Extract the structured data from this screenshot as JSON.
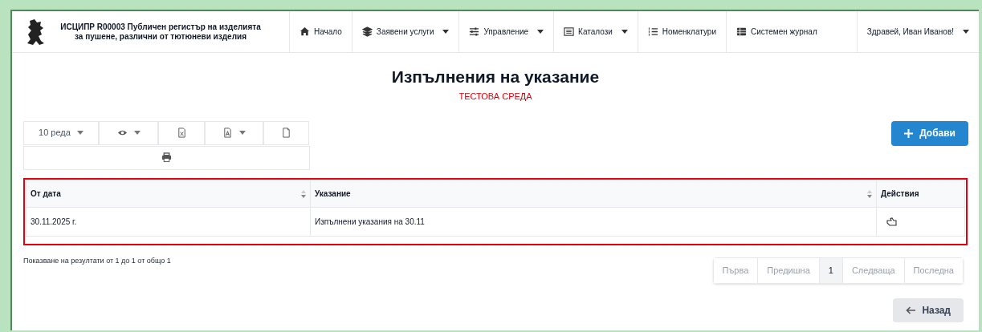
{
  "header": {
    "title": "ИСЦИПР R00003 Публичен регистър на изделията за пушене, различни от тютюневи изделия",
    "nav": [
      {
        "kind": "home",
        "label": "Начало",
        "dropdown": false
      },
      {
        "kind": "layers",
        "label": "Заявени услуги",
        "dropdown": true
      },
      {
        "kind": "sliders",
        "label": "Управление",
        "dropdown": true
      },
      {
        "kind": "catalog",
        "label": "Каталози",
        "dropdown": true
      },
      {
        "kind": "list",
        "label": "Номенклатури",
        "dropdown": false
      },
      {
        "kind": "journal",
        "label": "Системен журнал",
        "dropdown": false
      },
      {
        "kind": "user",
        "label": "Здравей, Иван Иванов!",
        "dropdown": true
      }
    ]
  },
  "page": {
    "title": "Изпълнения на указание",
    "environment": "ТЕСТОВА СРЕДА"
  },
  "toolbar": [
    {
      "kind": "rows",
      "label": "10 реда",
      "dropdown": true
    },
    {
      "kind": "columns",
      "dropdown": true
    },
    {
      "kind": "excel",
      "dropdown": false
    },
    {
      "kind": "pdf",
      "dropdown": true
    },
    {
      "kind": "document",
      "dropdown": false
    },
    {
      "kind": "print",
      "dropdown": false
    }
  ],
  "add_button": "Добави",
  "table": {
    "columns": [
      {
        "label": "От дата",
        "sortable": true
      },
      {
        "label": "Указание",
        "sortable": true
      },
      {
        "label": "Действия",
        "sortable": false
      }
    ],
    "rows": [
      [
        "30.11.2025 г.",
        "Изпълнени указания на 30.11"
      ]
    ]
  },
  "summary": "Показване на резултати от 1 до 1 от общо 1",
  "pagination": [
    {
      "label": "Първа",
      "selected": false,
      "disabled": true
    },
    {
      "label": "Предишна",
      "selected": false,
      "disabled": true
    },
    {
      "label": "1",
      "selected": true,
      "disabled": false
    },
    {
      "label": "Следваща",
      "selected": false,
      "disabled": true
    },
    {
      "label": "Последна",
      "selected": false,
      "disabled": true
    }
  ],
  "back_button": "Назад"
}
